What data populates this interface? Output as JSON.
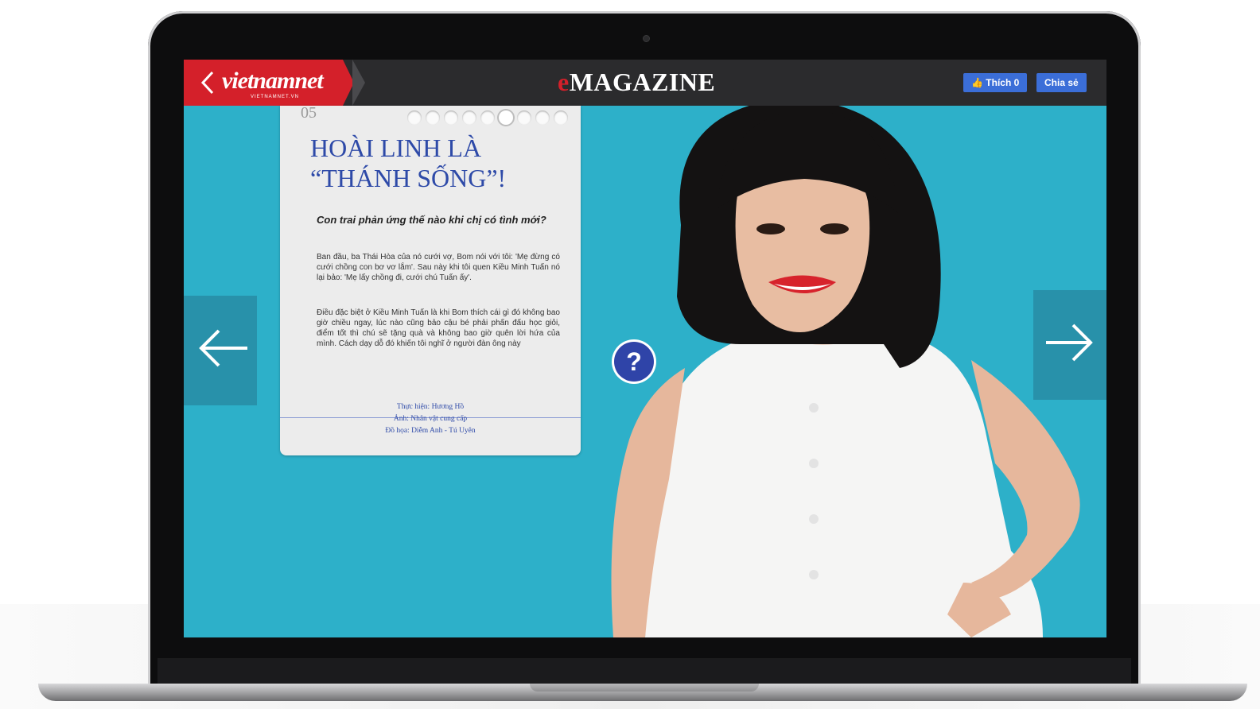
{
  "app": {
    "logo_text": "vietnamnet",
    "logo_subtext": "VIETNAMNET.VN",
    "title_prefix": "e",
    "title": "MAGAZINE",
    "like_label": "Thích 0",
    "share_label": "Chia sẻ"
  },
  "article": {
    "page_number": "05",
    "dots_total": 9,
    "dots_active_index": 5,
    "headline_line1": "HOÀI LINH LÀ",
    "headline_line2": "“THÁNH SỐNG”!",
    "question": "Con trai phản ứng thế nào khi chị có tình mới?",
    "paragraph1": "Ban đầu, ba Thái Hòa của nó cưới vợ, Bom nói với tôi: 'Mẹ đừng có cưới chồng con bơ vơ lắm'. Sau này khi tôi quen Kiều Minh Tuấn nó lại bảo: 'Mẹ lấy chồng đi, cưới chú Tuấn ấy'.",
    "paragraph2": "Điều đặc biệt ở Kiều Minh Tuấn là khi Bom thích cái gì đó không bao giờ chiều ngay, lúc nào cũng bảo cậu bé phải phấn đấu học giỏi, điểm tốt thì chú sẽ tặng quà và không bao giờ quên lời hứa của mình. Cách dạy dỗ đó khiến tôi nghĩ ở người đàn ông này",
    "credit1": "Thực hiện: Hương Hồ",
    "credit2": "Ảnh: Nhân vật cung cấp",
    "credit3": "Đồ họa: Diễm Anh - Tú Uyên"
  },
  "colors": {
    "screen_bg": "#2db0c9",
    "brand_red": "#d4202a",
    "headline_blue": "#2e4aa8",
    "fb_blue": "#3b6ed8"
  },
  "icons": {
    "back": "chevron-left-icon",
    "prev": "arrow-left-icon",
    "next": "arrow-right-icon",
    "help": "question-mark-icon",
    "like": "thumbs-up-icon"
  }
}
